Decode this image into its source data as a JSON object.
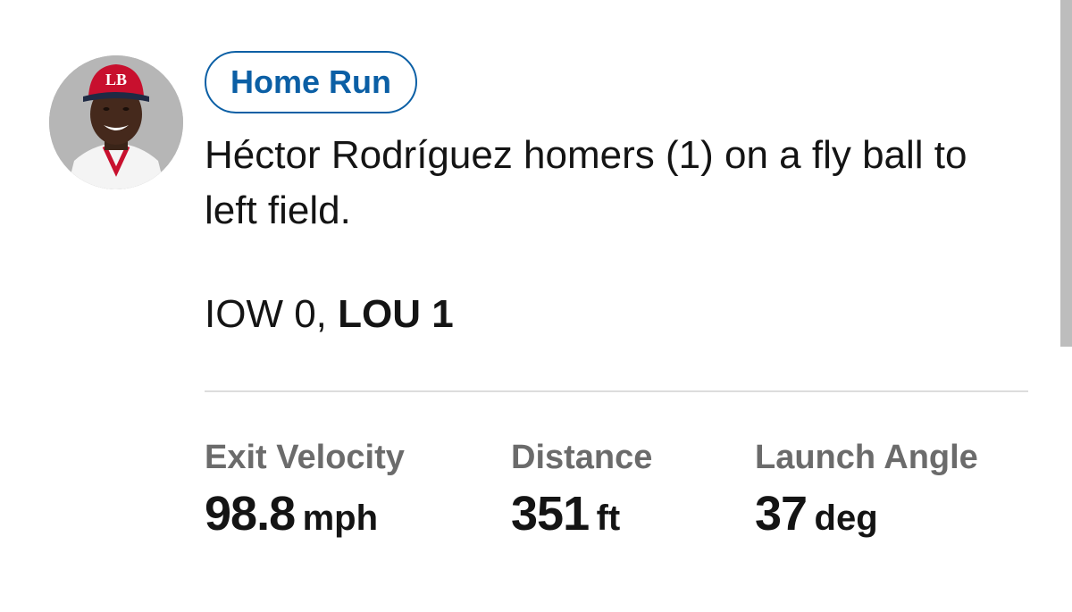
{
  "player": {
    "avatar": "player-headshot",
    "cap_logo": "LB"
  },
  "play": {
    "badge": "Home Run",
    "description": "Héctor Rodríguez homers (1) on a fly ball to left field."
  },
  "score": {
    "away": "IOW 0,",
    "home": "LOU 1"
  },
  "stats": [
    {
      "label": "Exit Velocity",
      "value": "98.8",
      "unit": "mph"
    },
    {
      "label": "Distance",
      "value": "351",
      "unit": "ft"
    },
    {
      "label": "Launch Angle",
      "value": "37",
      "unit": "deg"
    }
  ],
  "colors": {
    "accent": "#0b5fa5",
    "label_gray": "#6b6b6b",
    "divider": "#dddddd"
  }
}
